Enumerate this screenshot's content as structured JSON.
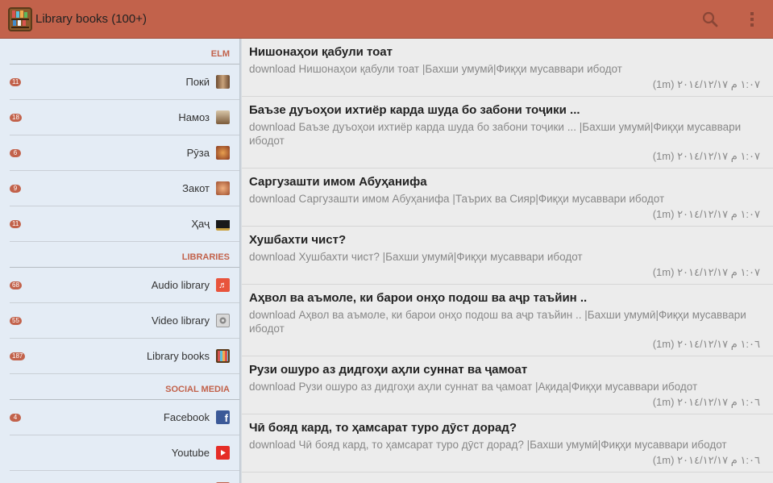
{
  "app": {
    "title": "Library books (100+)",
    "icon": "bookshelf-icon",
    "actions": [
      {
        "name": "search-icon"
      },
      {
        "name": "overflow-menu-icon"
      }
    ],
    "accent": "#c2624b"
  },
  "drawer": {
    "sections": [
      {
        "title": "ELM",
        "items": [
          {
            "label": "Покӣ",
            "count": "11",
            "icon": "ablution-icon"
          },
          {
            "label": "Намоз",
            "count": "18",
            "icon": "prayer-icon"
          },
          {
            "label": "Рӯза",
            "count": "6",
            "icon": "fasting-icon"
          },
          {
            "label": "Закот",
            "count": "9",
            "icon": "charity-icon"
          },
          {
            "label": "Ҳаҷ",
            "count": "11",
            "icon": "kaaba-icon"
          }
        ]
      },
      {
        "title": "LIBRARIES",
        "items": [
          {
            "label": "Audio library",
            "count": "68",
            "icon": "audio-library-icon"
          },
          {
            "label": "Video library",
            "count": "55",
            "icon": "video-library-icon"
          },
          {
            "label": "Library books",
            "count": "187",
            "icon": "library-books-icon"
          }
        ]
      },
      {
        "title": "SOCIAL MEDIA",
        "items": [
          {
            "label": "Facebook",
            "count": "4",
            "icon": "facebook-icon"
          },
          {
            "label": "Youtube",
            "count": "",
            "icon": "youtube-icon"
          }
        ]
      }
    ]
  },
  "books": [
    {
      "title": "Нишонаҳои қабули тоат",
      "description": "download Нишонаҳои қабули тоат |Бахши умумӣ|Фиқҳи мусаввари ибодот",
      "meta": "(1m) ١:٠٧ م ٢٠١٤/١٢/١٧"
    },
    {
      "title": "Баъзе дуъоҳои ихтиёр карда шуда бо забони тоҷики ...",
      "description": "download Баъзе дуъоҳои ихтиёр карда шуда бо забони тоҷики ... |Бахши умумӣ|Фиқҳи мусаввари ибодот",
      "meta": "(1m) ١:٠٧ م ٢٠١٤/١٢/١٧"
    },
    {
      "title": "Саргузашти имом Абуҳанифа",
      "description": "download Саргузашти имом Абуҳанифа |Таърих ва Сияр|Фиқҳи мусаввари ибодот",
      "meta": "(1m) ١:٠٧ م ٢٠١٤/١٢/١٧"
    },
    {
      "title": "Хушбахти чист?",
      "description": "download Хушбахти чист? |Бахши умумӣ|Фиқҳи мусаввари ибодот",
      "meta": "(1m) ١:٠٧ م ٢٠١٤/١٢/١٧"
    },
    {
      "title": "Аҳвол ва аъмоле, ки барои онҳо подош ва аҷр таъйин ..",
      "description": "download Аҳвол ва аъмоле, ки барои онҳо подош ва аҷр таъйин .. |Бахши умумӣ|Фиқҳи мусаввари ибодот",
      "meta": "(1m) ١:٠٦ م ٢٠١٤/١٢/١٧"
    },
    {
      "title": "Рузи ошуро аз дидгоҳи аҳли суннат ва ҷамоат",
      "description": "download Рузи ошуро аз дидгоҳи аҳли суннат ва ҷамоат |Ақида|Фиқҳи мусаввари ибодот",
      "meta": "(1m) ١:٠٦ م ٢٠١٤/١٢/١٧"
    },
    {
      "title": "Чӣ бояд кард, то ҳамсарат туро дӯст дорад?",
      "description": "download Чӣ бояд кард, то ҳамсарат туро дӯст дорад? |Бахши умумӣ|Фиқҳи мусаввари ибодот",
      "meta": "(1m) ١:٠٦ م ٢٠١٤/١٢/١٧"
    }
  ]
}
